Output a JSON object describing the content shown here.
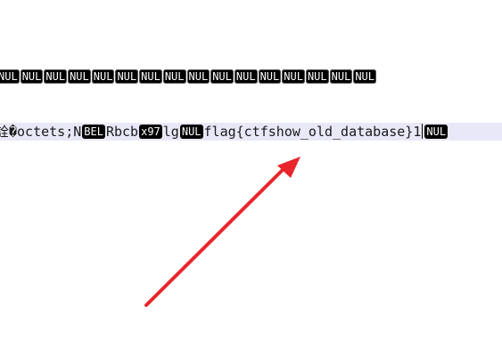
{
  "line1": {
    "tokens": [
      "NUL",
      "NUL",
      "NUL",
      "NUL",
      "NUL",
      "NUL",
      "NUL",
      "NUL",
      "NUL",
      "NUL",
      "NUL",
      "NUL",
      "NUL",
      "NUL",
      "NUL",
      "NUL"
    ]
  },
  "line2": {
    "lead_ctrl": "",
    "cjk": "詮�octets;",
    "t_n": "N",
    "bel": "BEL",
    "t_rbcb": "Rbcb",
    "x97": "x97",
    "t_lg": "lg",
    "nul1": "NUL",
    "flag": "flag{ctfshow_old_database}",
    "t_1": "1",
    "nul2": "NUL"
  },
  "annotation": {
    "color": "#e8262b",
    "icon": "arrow-icon"
  }
}
